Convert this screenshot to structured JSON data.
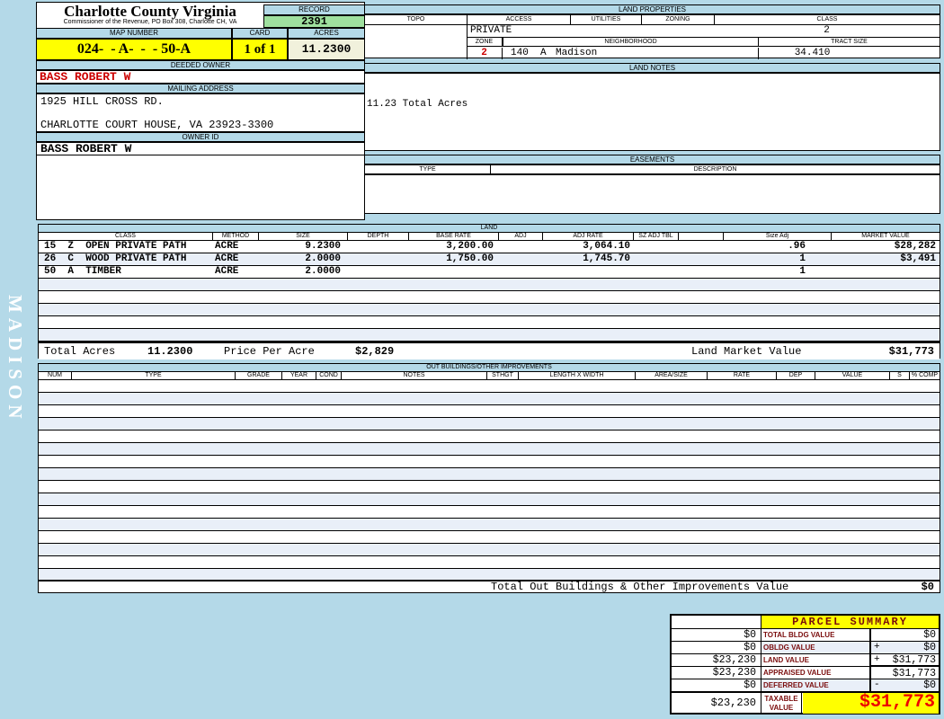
{
  "colors": {
    "page_bg": "#b4d9e8",
    "bar_blue": "#b4d9e8",
    "record_green": "#9fe09f",
    "highlight_yellow": "#ffff00",
    "acres_cream": "#f1f1dc",
    "row_alt": "#e9eff8",
    "owner_red": "#cc0000",
    "maroon": "#7a0c0c",
    "taxable_red": "#ee0000"
  },
  "sidebar": {
    "vertical_label": "MADISON"
  },
  "header": {
    "county_title": "Charlotte County Virginia",
    "county_subtitle": "Commissioner of the Revenue, PO Box 308, Charlotte CH, VA",
    "record_label": "RECORD",
    "record_value": "2391",
    "map_number_label": "MAP NUMBER",
    "map_number_value": "024-  - A-  -  - 50-A",
    "card_label": "CARD",
    "card_value": "1 of 1",
    "acres_label": "ACRES",
    "acres_value": "11.2300",
    "deeded_owner_label": "DEEDED OWNER",
    "deeded_owner_value": "BASS ROBERT W",
    "mailing_address_label": "MAILING ADDRESS",
    "address_line1": "1925 HILL CROSS RD.",
    "address_line2": "CHARLOTTE COURT HOUSE, VA 23923-3300",
    "owner_id_label": "OWNER ID",
    "owner_id_value": "BASS ROBERT W"
  },
  "land_properties": {
    "title": "LAND PROPERTIES",
    "col_topo": "TOPO",
    "col_access": "ACCESS",
    "col_utilities": "UTILITIES",
    "col_zoning": "ZONING",
    "col_class": "CLASS",
    "access_value": "PRIVATE",
    "class_value": "2",
    "zone_label": "ZONE",
    "neighborhood_label": "NEIGHBORHOOD",
    "tract_size_label": "TRACT SIZE",
    "zone_value": "2",
    "zone_code": "140  A",
    "neighborhood_value": "Madison",
    "tract_size_value": "34.410"
  },
  "land_notes": {
    "title": "LAND NOTES",
    "note": "11.23 Total Acres"
  },
  "easements": {
    "title": "EASEMENTS",
    "col_type": "TYPE",
    "col_description": "DESCRIPTION"
  },
  "land_table": {
    "title": "LAND",
    "headers": [
      "CLASS",
      "METHOD",
      "SIZE",
      "DEPTH",
      "BASE RATE",
      "ADJ",
      "ADJ RATE",
      "SZ ADJ TBL",
      "",
      "Size Adj",
      "MARKET VALUE"
    ],
    "rows": [
      {
        "class": "15  Z  OPEN PRIVATE PATH",
        "method": "ACRE",
        "size": "9.2300",
        "depth": "",
        "base_rate": "3,200.00",
        "adj": "",
        "adj_rate": "3,064.10",
        "sz_adj_tbl": "",
        "size_adj": ".96",
        "market_value": "$28,282"
      },
      {
        "class": "26  C  WOOD PRIVATE PATH",
        "method": "ACRE",
        "size": "2.0000",
        "depth": "",
        "base_rate": "1,750.00",
        "adj": "",
        "adj_rate": "1,745.70",
        "sz_adj_tbl": "",
        "size_adj": "1",
        "market_value": "$3,491"
      },
      {
        "class": "50  A  TIMBER",
        "method": "ACRE",
        "size": "2.0000",
        "depth": "",
        "base_rate": "",
        "adj": "",
        "adj_rate": "",
        "sz_adj_tbl": "",
        "size_adj": "1",
        "market_value": ""
      }
    ],
    "totals": {
      "total_acres_label": "Total Acres",
      "total_acres_value": "11.2300",
      "price_per_acre_label": "Price Per Acre",
      "price_per_acre_value": "$2,829",
      "land_market_value_label": "Land Market Value",
      "land_market_value": "$31,773"
    }
  },
  "out_buildings": {
    "title": "OUT BUILDINGS/OTHER IMPROVEMENTS",
    "headers": [
      "NUM",
      "TYPE",
      "GRADE",
      "YEAR",
      "COND",
      "NOTES",
      "STHGT",
      "LENGTH X WIDTH",
      "AREA/SIZE",
      "RATE",
      "DEP",
      "VALUE",
      "S",
      "% COMP"
    ],
    "total_label": "Total Out Buildings & Other Improvements Value",
    "total_value": "$0"
  },
  "parcel_summary": {
    "title": "PARCEL SUMMARY",
    "rows": [
      {
        "prev": "$0",
        "label": "TOTAL BLDG VALUE",
        "op": "",
        "value": "$0"
      },
      {
        "prev": "$0",
        "label": "OBLDG VALUE",
        "op": "+",
        "value": "$0"
      },
      {
        "prev": "$23,230",
        "label": "LAND VALUE",
        "op": "+",
        "value": "$31,773"
      },
      {
        "prev": "$23,230",
        "label": "APPRAISED VALUE",
        "op": "",
        "value": "$31,773"
      },
      {
        "prev": "$0",
        "label": "DEFERRED VALUE",
        "op": "-",
        "value": "$0"
      }
    ],
    "taxable": {
      "prev": "$23,230",
      "label": "TAXABLE VALUE",
      "value": "$31,773"
    }
  }
}
